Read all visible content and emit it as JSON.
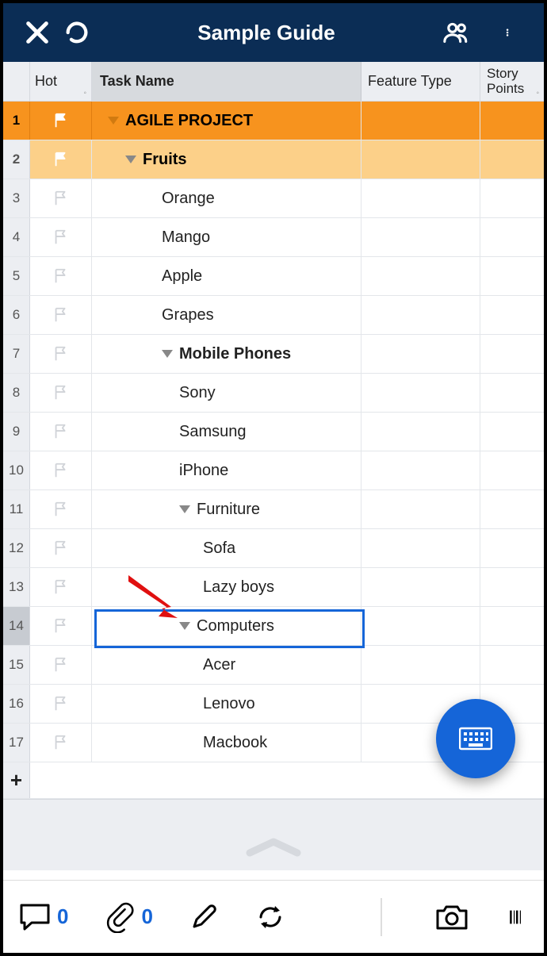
{
  "header": {
    "title": "Sample Guide"
  },
  "columns": {
    "hot": "Hot",
    "task": "Task Name",
    "feature": "Feature Type",
    "story": "Story Points"
  },
  "rows": [
    {
      "n": "1",
      "level": 0,
      "expand": true,
      "flag": "white",
      "task": "AGILE PROJECT"
    },
    {
      "n": "2",
      "level": 1,
      "expand": true,
      "flag": "white",
      "task": "Fruits"
    },
    {
      "n": "3",
      "level": 2,
      "expand": false,
      "flag": "outline",
      "task": "Orange"
    },
    {
      "n": "4",
      "level": 2,
      "expand": false,
      "flag": "outline",
      "task": "Mango"
    },
    {
      "n": "5",
      "level": 2,
      "expand": false,
      "flag": "outline",
      "task": "Apple"
    },
    {
      "n": "6",
      "level": 2,
      "expand": false,
      "flag": "outline",
      "task": "Grapes"
    },
    {
      "n": "7",
      "level": 2,
      "expand": true,
      "flag": "outline",
      "task": "Mobile Phones",
      "bold": true
    },
    {
      "n": "8",
      "level": 3,
      "expand": false,
      "flag": "outline",
      "task": "Sony"
    },
    {
      "n": "9",
      "level": 3,
      "expand": false,
      "flag": "outline",
      "task": "Samsung"
    },
    {
      "n": "10",
      "level": 3,
      "expand": false,
      "flag": "outline",
      "task": "iPhone"
    },
    {
      "n": "11",
      "level": 3,
      "expand": true,
      "flag": "outline",
      "task": "Furniture"
    },
    {
      "n": "12",
      "level": 4,
      "expand": false,
      "flag": "outline",
      "task": "Sofa"
    },
    {
      "n": "13",
      "level": 4,
      "expand": false,
      "flag": "outline",
      "task": "Lazy boys"
    },
    {
      "n": "14",
      "level": 3,
      "expand": true,
      "flag": "outline",
      "task": "Computers",
      "selected": true
    },
    {
      "n": "15",
      "level": 4,
      "expand": false,
      "flag": "outline",
      "task": "Acer"
    },
    {
      "n": "16",
      "level": 4,
      "expand": false,
      "flag": "outline",
      "task": "Lenovo"
    },
    {
      "n": "17",
      "level": 4,
      "expand": false,
      "flag": "outline",
      "task": "Macbook"
    }
  ],
  "bottom": {
    "comments": "0",
    "attachments": "0"
  },
  "plus": "+"
}
